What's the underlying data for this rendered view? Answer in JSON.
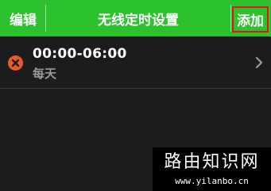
{
  "header": {
    "edit_label": "编辑",
    "title": "无线定时设置",
    "add_label": "添加",
    "bg_color": "#2dc22d",
    "highlight_color": "#e01818"
  },
  "schedules": [
    {
      "time_range": "00:00-06:00",
      "repeat": "每天",
      "delete_icon": "delete-circle-icon",
      "arrow_icon": "chevron-right-icon"
    }
  ],
  "watermark": {
    "title": "路由知识网",
    "url": "www.yilanbo.cn"
  }
}
